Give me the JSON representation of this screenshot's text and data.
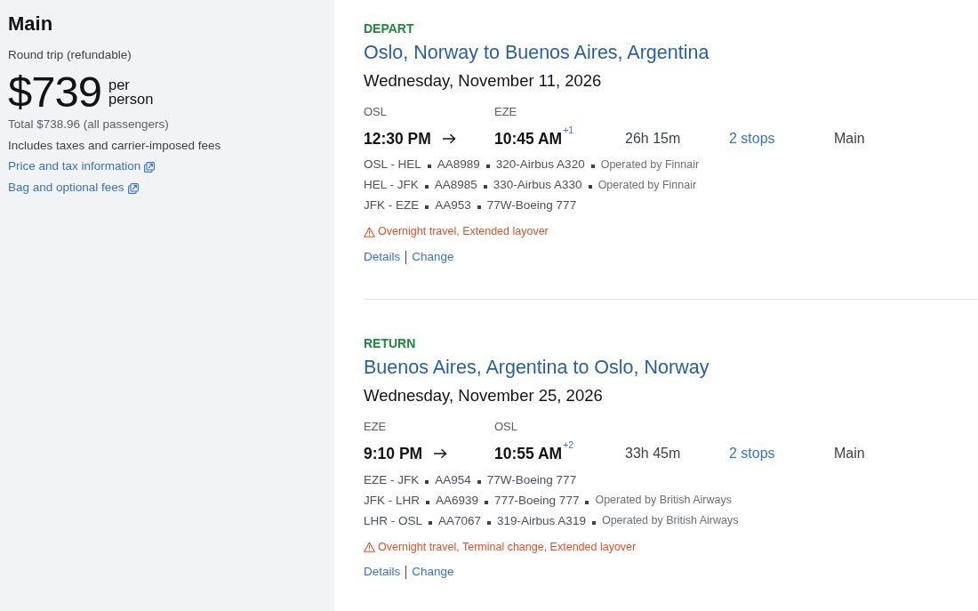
{
  "summary": {
    "cabin": "Main",
    "trip_type": "Round trip (refundable)",
    "price": "$739",
    "price_unit": "per person",
    "total": "Total $738.96 (all passengers)",
    "fees_note": "Includes taxes and carrier-imposed fees",
    "links": [
      "Price and tax information",
      "Bag and optional fees"
    ]
  },
  "slices": [
    {
      "label": "DEPART",
      "route": "Oslo, Norway to Buenos Aires, Argentina",
      "date": "Wednesday, November 11, 2026",
      "origin": "OSL",
      "destination": "EZE",
      "depart_time": "12:30 PM",
      "arrive_time": "10:45 AM",
      "day_offset": "+1",
      "duration": "26h 15m",
      "stops": "2 stops",
      "cabin": "Main",
      "segments": [
        {
          "route": "OSL - HEL",
          "flight": "AA8989",
          "aircraft": "320-Airbus A320",
          "operator": "Operated by Finnair"
        },
        {
          "route": "HEL - JFK",
          "flight": "AA8985",
          "aircraft": "330-Airbus A330",
          "operator": "Operated by Finnair"
        },
        {
          "route": "JFK - EZE",
          "flight": "AA953",
          "aircraft": "77W-Boeing 777"
        }
      ],
      "warning": "Overnight travel, Extended layover",
      "links": [
        "Details",
        "Change"
      ]
    },
    {
      "label": "RETURN",
      "route": "Buenos Aires, Argentina to Oslo, Norway",
      "date": "Wednesday, November 25, 2026",
      "origin": "EZE",
      "destination": "OSL",
      "depart_time": "9:10 PM",
      "arrive_time": "10:55 AM",
      "day_offset": "+2",
      "duration": "33h 45m",
      "stops": "2 stops",
      "cabin": "Main",
      "segments": [
        {
          "route": "EZE - JFK",
          "flight": "AA954",
          "aircraft": "77W-Boeing 777"
        },
        {
          "route": "JFK - LHR",
          "flight": "AA6939",
          "aircraft": "777-Boeing 777",
          "operator": "Operated by British Airways"
        },
        {
          "route": "LHR - OSL",
          "flight": "AA7067",
          "aircraft": "319-Airbus A319",
          "operator": "Operated by British Airways"
        }
      ],
      "warning": "Overnight travel, Terminal change, Extended layover",
      "links": [
        "Details",
        "Change"
      ]
    }
  ]
}
